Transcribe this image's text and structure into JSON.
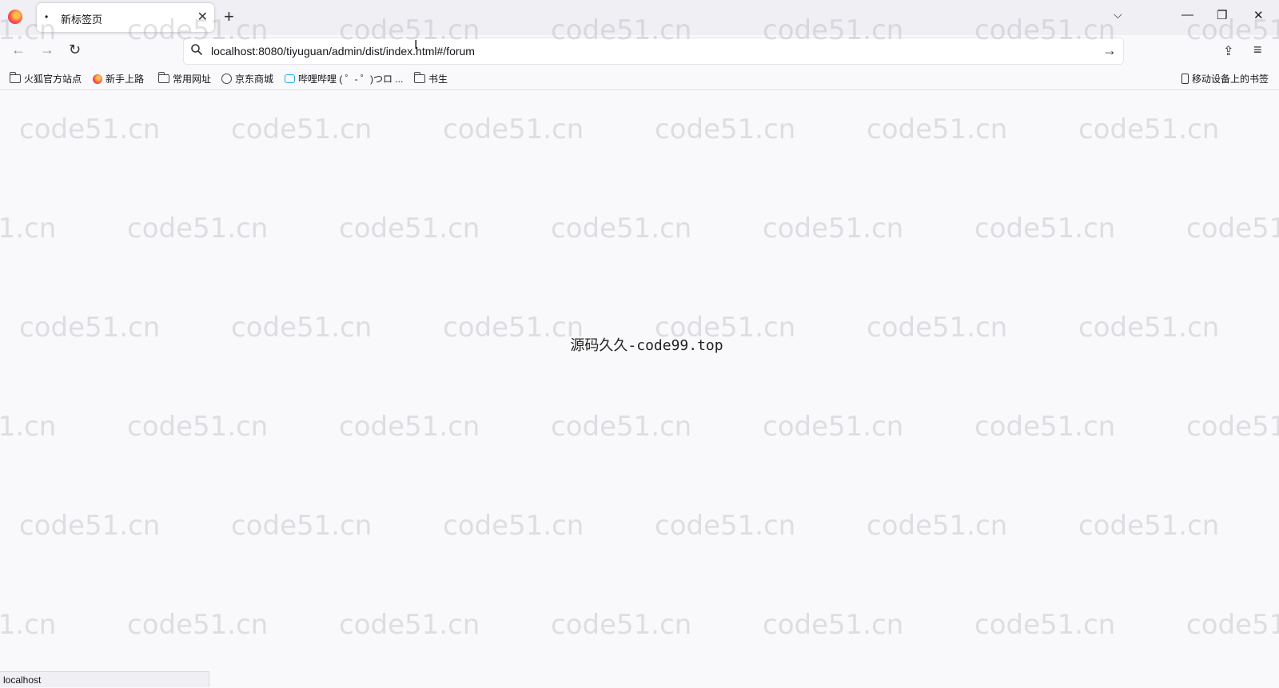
{
  "tab": {
    "dot": "•",
    "title": "新标签页",
    "close": "✕"
  },
  "tabbar": {
    "new_tab": "+",
    "tab_list": "⌵"
  },
  "window": {
    "minimize": "—",
    "restore": "❐",
    "close": "✕"
  },
  "nav": {
    "back": "←",
    "forward": "→",
    "reload": "↻",
    "url": "localhost:8080/tiyuguan/admin/dist/index.html#/forum",
    "go": "→",
    "extensions": "⇪",
    "menu": "≡"
  },
  "bookmarks": {
    "items": [
      {
        "label": "火狐官方站点",
        "icon": "folder-icon"
      },
      {
        "label": "新手上路",
        "icon": "firefox-icon"
      },
      {
        "label": "常用网址",
        "icon": "folder-icon"
      },
      {
        "label": "京东商城",
        "icon": "globe-icon"
      },
      {
        "label": "哔哩哔哩 ( ゜- ゜)つロ ...",
        "icon": "bilibili-icon"
      },
      {
        "label": "书生",
        "icon": "folder-icon"
      }
    ],
    "mobile": "移动设备上的书签"
  },
  "content": {
    "center_text": "源码久久-code99.top"
  },
  "watermark": {
    "text": "code51.cn"
  },
  "status": {
    "text": "localhost"
  },
  "colors": {
    "background": "#f9f9fb",
    "tabstrip": "#f0f0f4",
    "accent": "#23ade5"
  }
}
